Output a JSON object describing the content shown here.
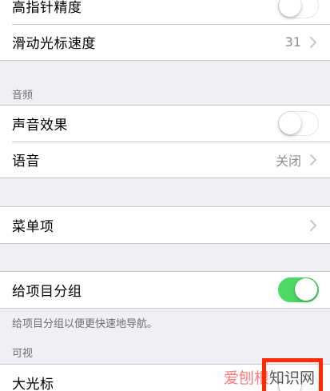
{
  "pointer": {
    "precision_label": "高指针精度",
    "precision_on": false,
    "speed_label": "滑动光标速度",
    "speed_value": "31"
  },
  "audio": {
    "header": "音频",
    "sound_effects_label": "声音效果",
    "sound_effects_on": false,
    "speech_label": "语音",
    "speech_value": "关闭"
  },
  "menu": {
    "menu_items_label": "菜单项"
  },
  "grouping": {
    "group_items_label": "给项目分组",
    "group_items_on": true,
    "footer": "给项目分组以便更快速地导航。"
  },
  "visible": {
    "header": "可视",
    "large_cursor_label": "大光标"
  },
  "watermark": {
    "part_a": "爱刨根",
    "part_b": "知识网"
  },
  "colors": {
    "background": "#efeff4",
    "toggle_on": "#4cd964",
    "watermark_box": "#ff2a00"
  }
}
